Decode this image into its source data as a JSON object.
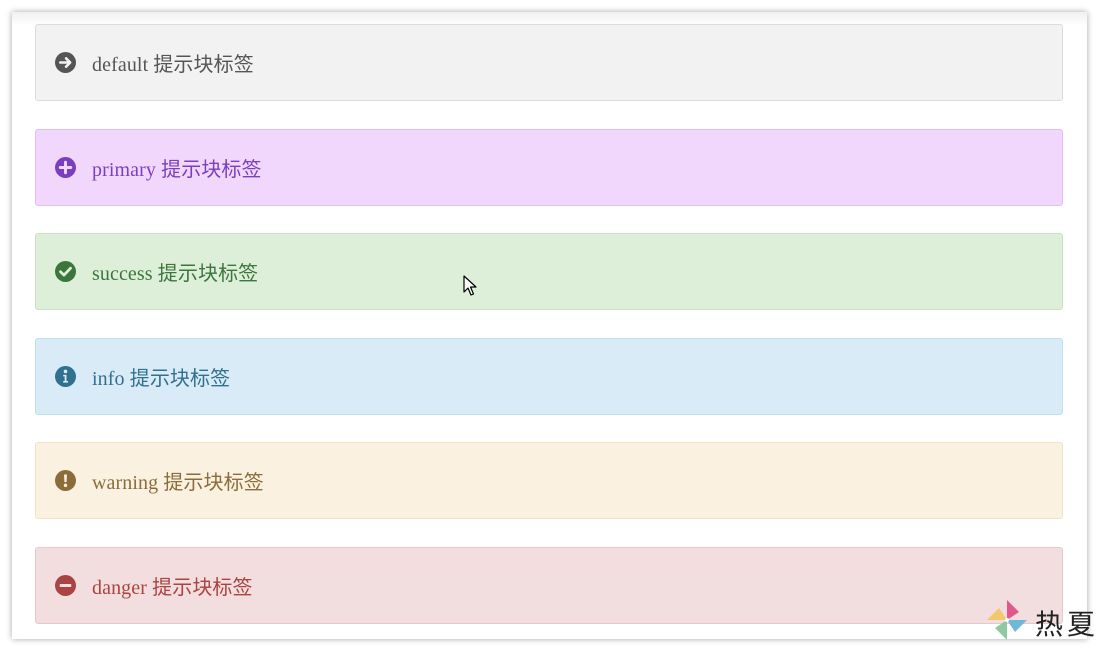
{
  "alerts": [
    {
      "type": "default",
      "label": "default 提示块标签",
      "icon": "arrow-circle-right-icon",
      "color": "#555555",
      "background": "#f2f2f2"
    },
    {
      "type": "primary",
      "label": "primary 提示块标签",
      "icon": "plus-circle-icon",
      "color": "#7a3fbe",
      "background": "#f2d7fd"
    },
    {
      "type": "success",
      "label": "success 提示块标签",
      "icon": "check-circle-icon",
      "color": "#3c763d",
      "background": "#ddefd8"
    },
    {
      "type": "info",
      "label": "info 提示块标签",
      "icon": "info-circle-icon",
      "color": "#31708f",
      "background": "#d8ebf6"
    },
    {
      "type": "warning",
      "label": "warning 提示块标签",
      "icon": "exclamation-circle-icon",
      "color": "#8a6d3b",
      "background": "#fbf1e0"
    },
    {
      "type": "danger",
      "label": "danger 提示块标签",
      "icon": "minus-circle-icon",
      "color": "#a94442",
      "background": "#f2dede"
    }
  ],
  "watermark": {
    "text": "热夏",
    "icon": "pinwheel-logo-icon"
  }
}
